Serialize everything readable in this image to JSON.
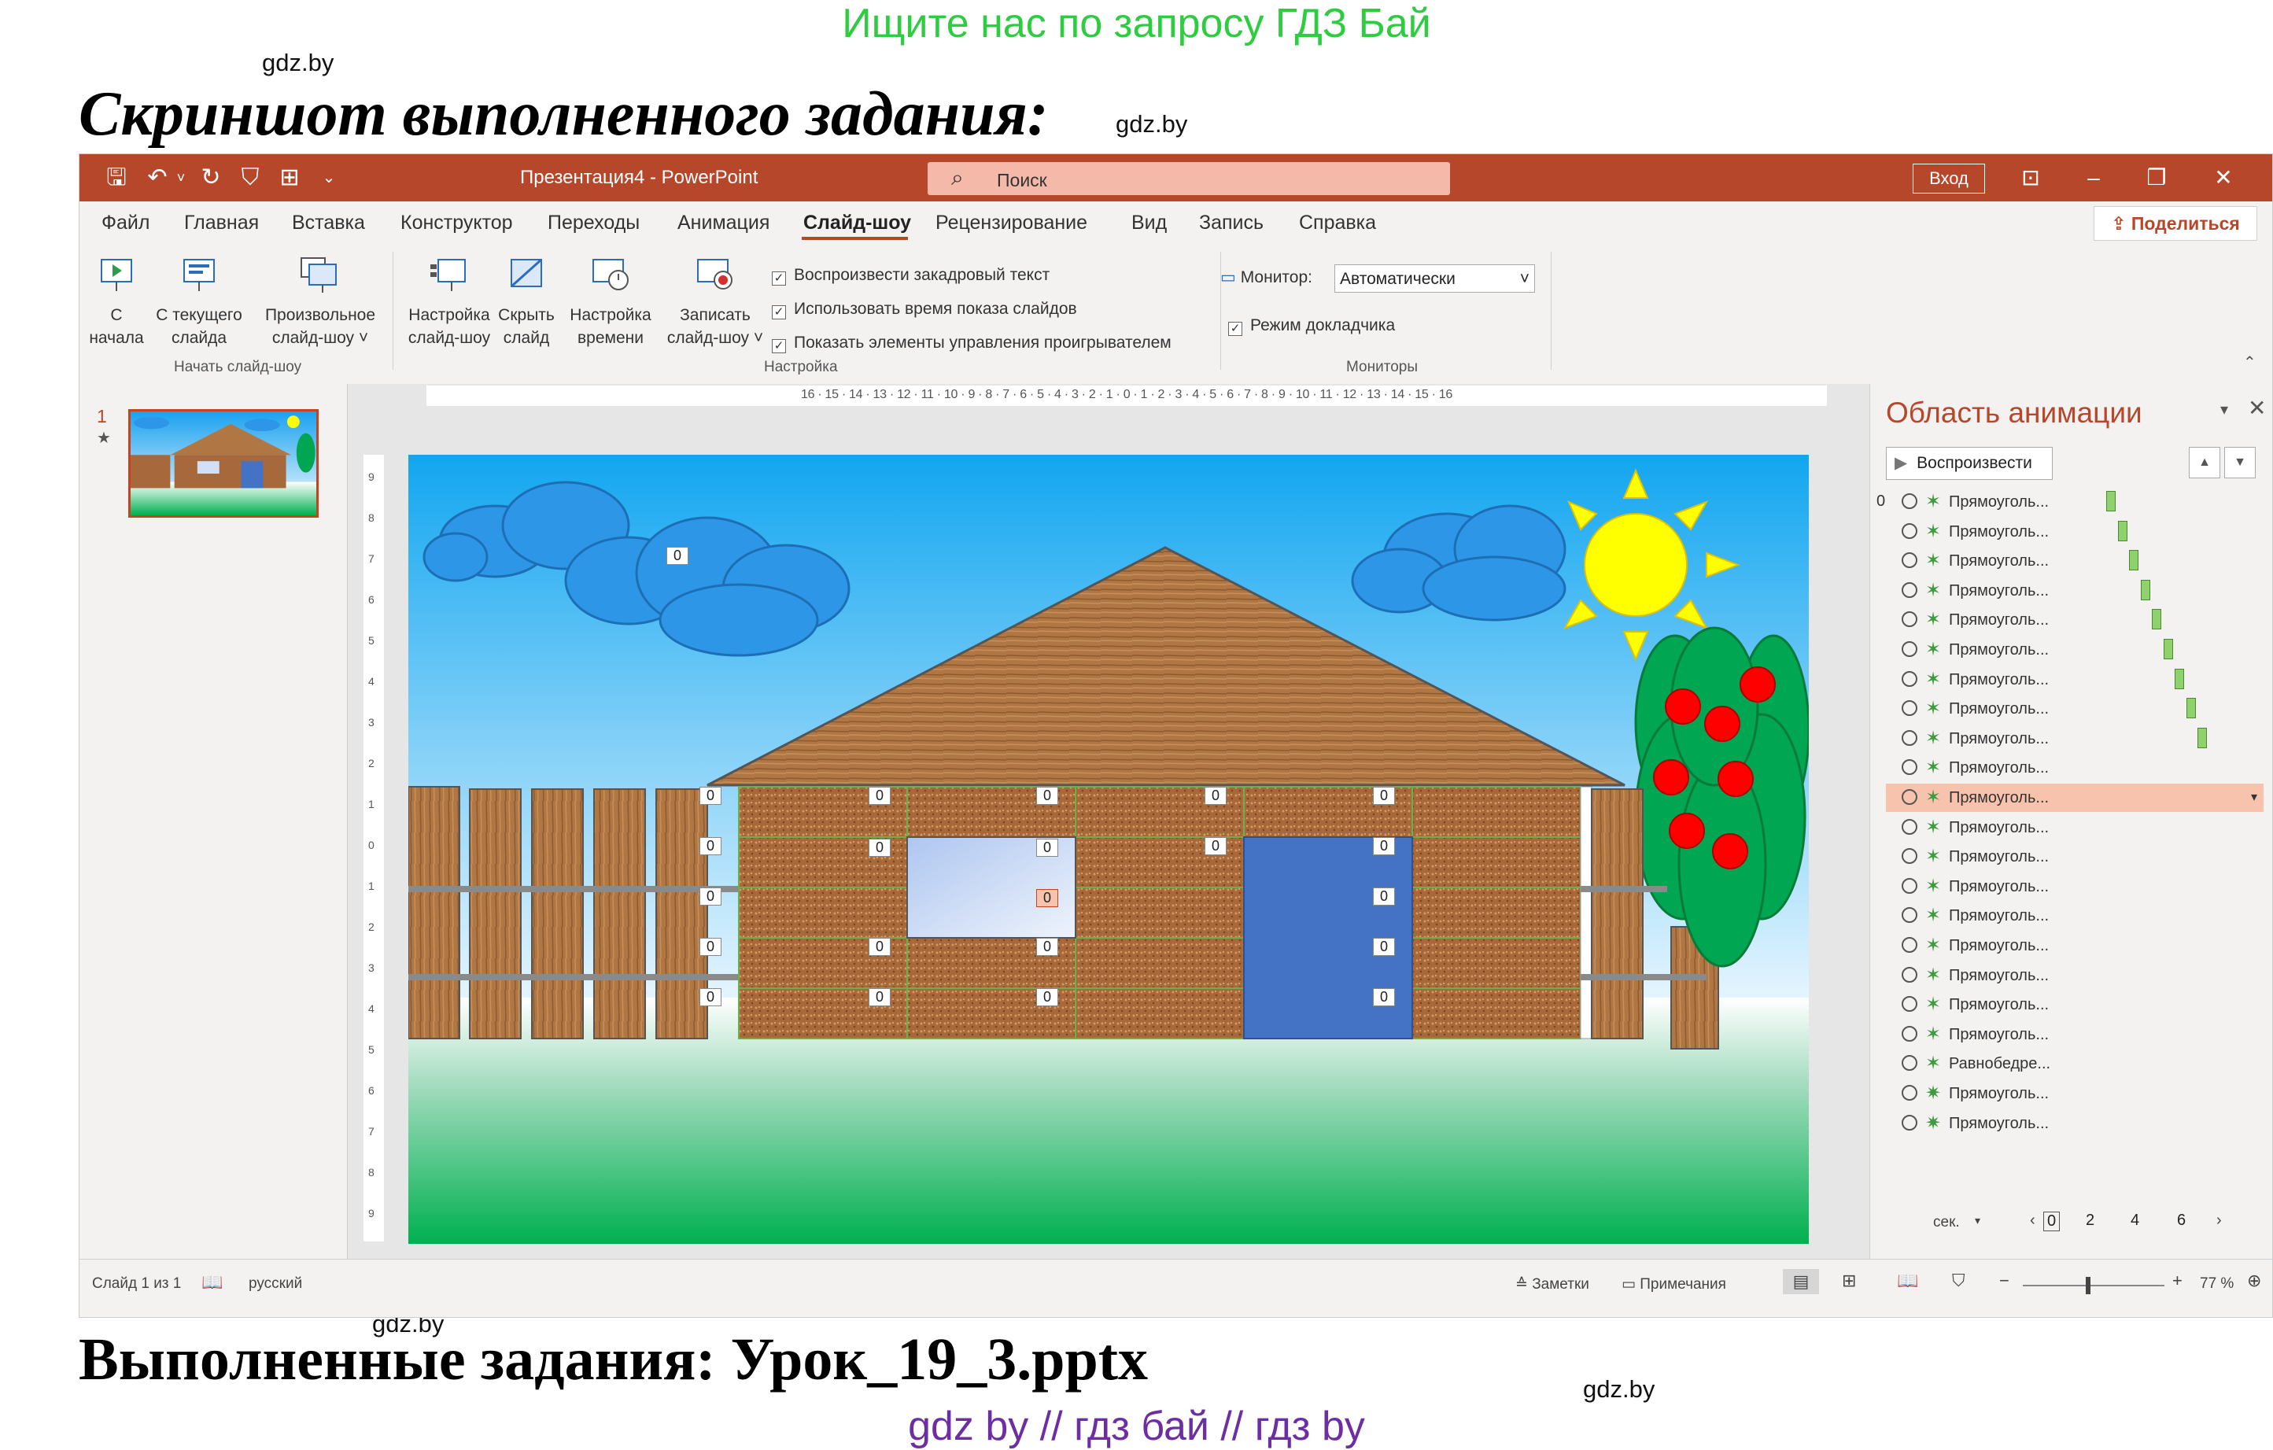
{
  "banner_top": "Ищите нас по запросу ГДЗ Бай",
  "heading_top": "Скриншот выполненного задания:",
  "heading_bottom": "Выполненные задания: Урок_19_3.pptx",
  "banner_bottom": "gdz by  //  гдз бай  //  гдз by",
  "watermark": "gdz.by",
  "app": {
    "title": "Презентация4  -  PowerPoint",
    "search_placeholder": "Поиск",
    "signin": "Вход",
    "share": "Поделиться",
    "tabs": [
      "Файл",
      "Главная",
      "Вставка",
      "Конструктор",
      "Переходы",
      "Анимация",
      "Слайд-шоу",
      "Рецензирование",
      "Вид",
      "Запись",
      "Справка"
    ],
    "active_tab": "Слайд-шоу",
    "ribbon": {
      "from_start": [
        "С",
        "начала"
      ],
      "from_current": [
        "С текущего",
        "слайда"
      ],
      "custom": [
        "Произвольное",
        "слайд-шоу ˅"
      ],
      "group_start": "Начать слайд-шоу",
      "setup": [
        "Настройка",
        "слайд-шоу"
      ],
      "hide": [
        "Скрыть",
        "слайд"
      ],
      "timing": [
        "Настройка",
        "времени"
      ],
      "record": [
        "Записать",
        "слайд-шоу ˅"
      ],
      "chk_narration": "Воспроизвести закадровый текст",
      "chk_timings": "Использовать время показа слайдов",
      "chk_controls": "Показать элементы управления проигрывателем",
      "group_setup": "Настройка",
      "monitor_label": "Монитор:",
      "monitor_value": "Автоматически",
      "chk_presenter": "Режим докладчика",
      "group_monitors": "Мониторы"
    },
    "slide_number": "1",
    "ruler_numbers": "16 · 15 · 14 · 13 · 12 · 11 · 10 · 9 · 8 · 7 · 6 · 5 · 4 · 3 · 2 · 1 · 0 · 1 · 2 · 3 · 4 · 5 · 6 · 7 · 8 · 9 · 10 · 11 · 12 · 13 · 14 · 15 · 16",
    "slide_tag": "0",
    "anim_pane": {
      "title": "Область анимации",
      "play": "Воспроизвести",
      "first_marker": "0",
      "items": [
        "Прямоуголь...",
        "Прямоуголь...",
        "Прямоуголь...",
        "Прямоуголь...",
        "Прямоуголь...",
        "Прямоуголь...",
        "Прямоуголь...",
        "Прямоуголь...",
        "Прямоуголь...",
        "Прямоуголь...",
        "Прямоуголь...",
        "Прямоуголь...",
        "Прямоуголь...",
        "Прямоуголь...",
        "Прямоуголь...",
        "Прямоуголь...",
        "Прямоуголь...",
        "Прямоуголь...",
        "Прямоуголь...",
        "Равнобедре...",
        "Прямоуголь...",
        "Прямоуголь..."
      ],
      "selected_index": 10,
      "sec_label": "сек.",
      "timeline": [
        "0",
        "2",
        "4",
        "6"
      ]
    },
    "status": {
      "slide": "Слайд 1 из 1",
      "lang": "русский",
      "notes": "Заметки",
      "comments": "Примечания",
      "zoom": "77 %"
    }
  },
  "colors": {
    "accent": "#b7472a",
    "sky": "#2196f3",
    "grass": "#2ecc71"
  }
}
